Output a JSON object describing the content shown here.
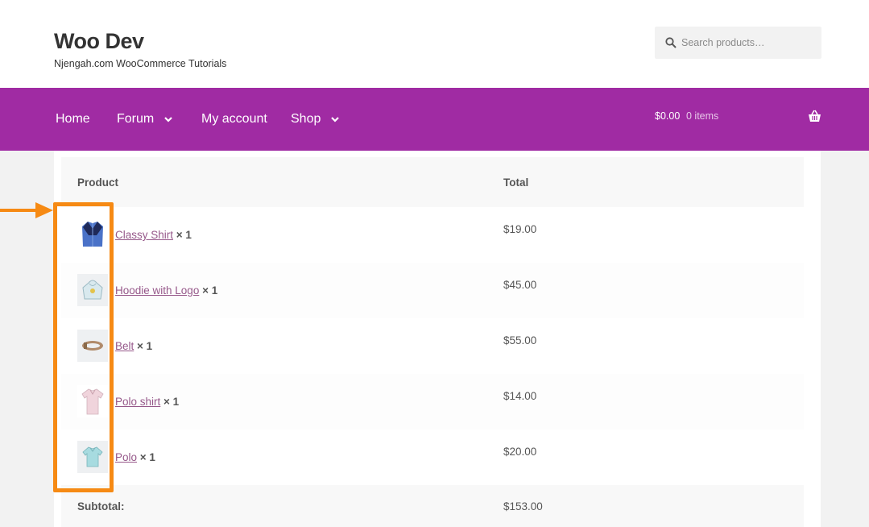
{
  "site": {
    "title": "Woo Dev",
    "tagline": "Njengah.com WooCommerce Tutorials"
  },
  "search": {
    "placeholder": "Search products…"
  },
  "nav": {
    "items": [
      {
        "label": "Home",
        "has_dropdown": false
      },
      {
        "label": "Forum",
        "has_dropdown": true
      },
      {
        "label": "My account",
        "has_dropdown": false
      },
      {
        "label": "Shop",
        "has_dropdown": true
      }
    ],
    "cart_amount": "$0.00",
    "cart_count": "0 items"
  },
  "order_table": {
    "headers": {
      "product": "Product",
      "total": "Total"
    },
    "items": [
      {
        "name": "Classy Shirt",
        "qty": "× 1",
        "total": "$19.00",
        "icon": "shirt-icon"
      },
      {
        "name": "Hoodie with Logo",
        "qty": "× 1",
        "total": "$45.00",
        "icon": "hoodie-icon"
      },
      {
        "name": "Belt",
        "qty": "× 1",
        "total": "$55.00",
        "icon": "belt-icon"
      },
      {
        "name": "Polo shirt",
        "qty": "× 1",
        "total": "$14.00",
        "icon": "polo-shirt-icon"
      },
      {
        "name": "Polo",
        "qty": "× 1",
        "total": "$20.00",
        "icon": "polo-icon"
      }
    ],
    "subtotal_label": "Subtotal:",
    "subtotal_value": "$153.00"
  },
  "colors": {
    "nav_bg": "#a02ba3",
    "link": "#96588a",
    "highlight": "#f68a14"
  }
}
